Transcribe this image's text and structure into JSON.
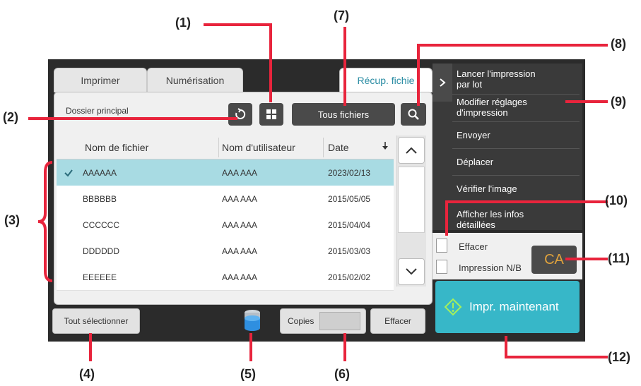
{
  "callouts": [
    "(1)",
    "(2)",
    "(3)",
    "(4)",
    "(5)",
    "(6)",
    "(7)",
    "(8)",
    "(9)",
    "(10)",
    "(11)",
    "(12)"
  ],
  "tabs": {
    "print": "Imprimer",
    "scan": "Numérisation",
    "retrieve": "Récup. fichie"
  },
  "toolbar": {
    "folder": "Dossier principal",
    "all_files": "Tous fichiers"
  },
  "table": {
    "columns": [
      "Nom de fichier",
      "Nom d'utilisateur",
      "Date"
    ],
    "rows": [
      {
        "name": "AAAAAA",
        "user": "AAA AAA",
        "date": "2023/02/13",
        "selected": true
      },
      {
        "name": "BBBBBB",
        "user": "AAA AAA",
        "date": "2015/05/05",
        "selected": false
      },
      {
        "name": "CCCCCC",
        "user": "AAA AAA",
        "date": "2015/04/04",
        "selected": false
      },
      {
        "name": "DDDDDD",
        "user": "AAA AAA",
        "date": "2015/03/03",
        "selected": false
      },
      {
        "name": "EEEEEE",
        "user": "AAA AAA",
        "date": "2015/02/02",
        "selected": false
      }
    ]
  },
  "menu": {
    "batch_print": [
      "Lancer l'impression",
      "par lot"
    ],
    "change_settings": [
      "Modifier réglages",
      "d'impression"
    ],
    "send": "Envoyer",
    "move": "Déplacer",
    "check_image": "Vérifier l'image",
    "details": [
      "Afficher les infos",
      "détaillées"
    ]
  },
  "options": {
    "delete": "Effacer",
    "bw_print": "Impression N/B"
  },
  "ca_label": "CA",
  "print_now": "Impr. maintenant",
  "bottom": {
    "select_all": "Tout sélectionner",
    "copies": "Copies",
    "clear": "Effacer"
  },
  "colors": {
    "callout_line": "#e8243c",
    "selected_row": "#a8dbe3",
    "print_button": "#37b7c8",
    "ca_text": "#e0a23c"
  }
}
